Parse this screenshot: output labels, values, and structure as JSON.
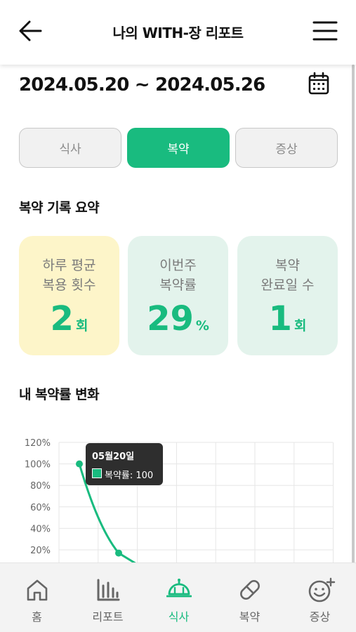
{
  "header": {
    "title": "나의 WITH-장 리포트",
    "back_icon": "arrow-left-icon",
    "menu_icon": "hamburger-menu-icon"
  },
  "date_range": "2024.05.20 ~ 2024.05.26",
  "tabs": [
    {
      "label": "식사",
      "active": false
    },
    {
      "label": "복약",
      "active": true
    },
    {
      "label": "증상",
      "active": false
    }
  ],
  "summary": {
    "title": "복약 기록 요약",
    "cards": [
      {
        "label": "하루 평균\n복용 횟수",
        "value": "2",
        "unit": "회",
        "bg": "#fdf5c9"
      },
      {
        "label": "이번주\n복약률",
        "value": "29",
        "unit": "%",
        "bg": "#e3f3ec"
      },
      {
        "label": "복약\n완료일 수",
        "value": "1",
        "unit": "회",
        "bg": "#e3f3ec"
      }
    ]
  },
  "chart_section_title": "내 복약률 변화",
  "chart_data": {
    "type": "line",
    "yticks": [
      "120%",
      "100%",
      "80%",
      "60%",
      "40%",
      "20%"
    ],
    "ylim": [
      0,
      120
    ],
    "series": [
      {
        "name": "복약률",
        "values": [
          100,
          17,
          5
        ]
      }
    ],
    "grid": true,
    "color": "#19bb7f"
  },
  "tooltip": {
    "title": "05월20일",
    "text": "복약률: 100"
  },
  "bottom_nav": [
    {
      "label": "홈",
      "icon": "home-icon",
      "active": false
    },
    {
      "label": "리포트",
      "icon": "bar-chart-icon",
      "active": false
    },
    {
      "label": "식사",
      "icon": "meal-dome-icon",
      "active": true
    },
    {
      "label": "복약",
      "icon": "pill-icon",
      "active": false
    },
    {
      "label": "증상",
      "icon": "smiley-plus-icon",
      "active": false
    }
  ],
  "colors": {
    "accent": "#19bb7f",
    "text_dark": "#111111",
    "muted": "#7a7a7a"
  }
}
